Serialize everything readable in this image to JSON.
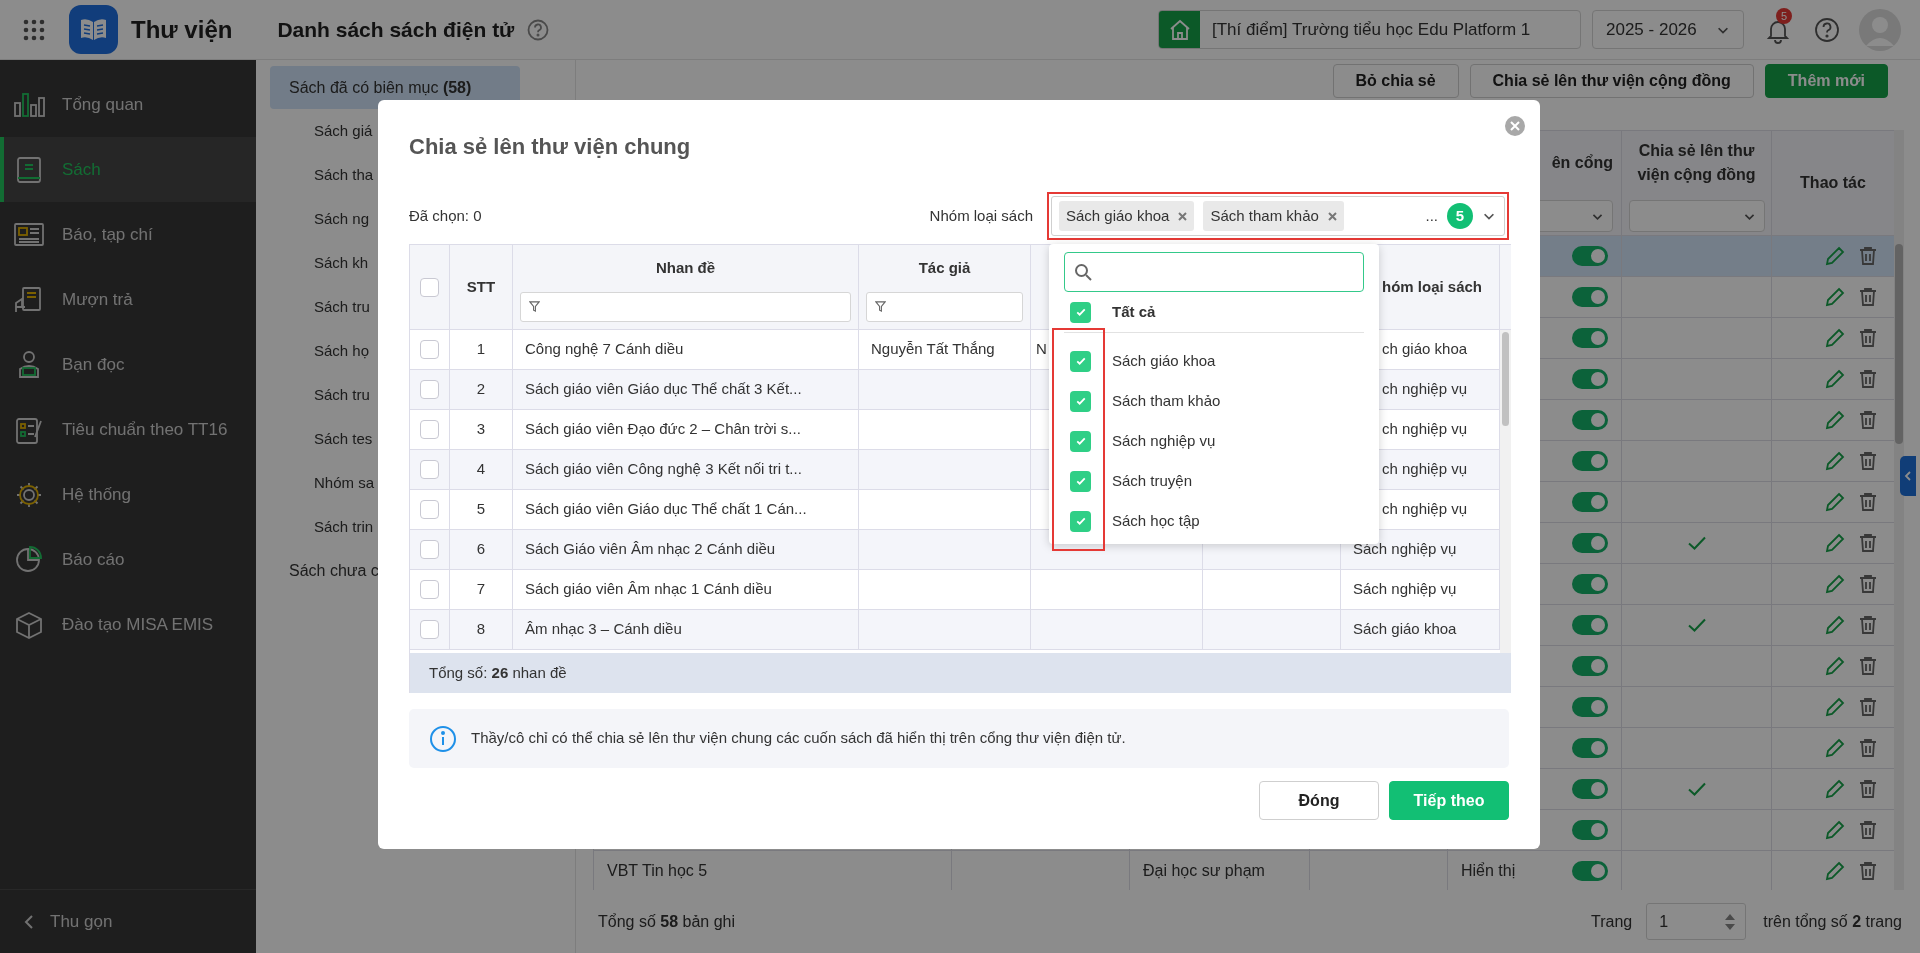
{
  "app": {
    "title": "Thư viện"
  },
  "header": {
    "title": "Danh sách sách điện tử",
    "school": "[Thí điểm] Trường tiểu học Edu Platform 1",
    "year": "2025 - 2026",
    "notification_count": "5"
  },
  "sidebar": {
    "items": [
      {
        "label": "Tổng quan",
        "kind": "overview",
        "selected": false
      },
      {
        "label": "Sách",
        "kind": "book",
        "selected": true
      },
      {
        "label": "Báo, tạp chí",
        "kind": "newspaper",
        "selected": false
      },
      {
        "label": "Mượn trả",
        "kind": "borrow",
        "selected": false
      },
      {
        "label": "Bạn đọc",
        "kind": "reader",
        "selected": false
      },
      {
        "label": "Tiêu chuẩn theo TT16",
        "kind": "checklist",
        "selected": false
      },
      {
        "label": "Hệ thống",
        "kind": "gear",
        "selected": false
      },
      {
        "label": "Báo cáo",
        "kind": "report",
        "selected": false
      },
      {
        "label": "Đào tạo MISA EMIS",
        "kind": "training",
        "selected": false
      }
    ],
    "collapse": "Thu gọn"
  },
  "categories": [
    {
      "label": "Sách đã có biên mục **(58)**",
      "selected": true,
      "children": [
        {
          "label": "Sách giá",
          "selected": false
        },
        {
          "label": "Sách tha",
          "selected": false
        },
        {
          "label": "Sách ng",
          "selected": false
        },
        {
          "label": "Sách kh",
          "selected": false
        },
        {
          "label": "Sách tru",
          "selected": false
        },
        {
          "label": "Sách họ",
          "selected": false
        },
        {
          "label": "Sách tru",
          "selected": false
        },
        {
          "label": "Sách tes",
          "selected": false
        },
        {
          "label": "Nhóm sa",
          "selected": false
        },
        {
          "label": "Sách trin",
          "selected": false
        }
      ]
    },
    {
      "label": "Sách chưa c",
      "selected": false
    }
  ],
  "toolbar": [
    {
      "label": "Bỏ chia sẻ",
      "kind": "outline"
    },
    {
      "label": "Chia sẻ lên thư viện cộng đồng",
      "kind": "outline"
    },
    {
      "label": "Thêm mới",
      "kind": "primary"
    }
  ],
  "books_table": {
    "columns": [
      "ên cổng",
      "Chia sẻ lên thư viện cộng đồng",
      "Thao tác"
    ],
    "rows": [
      {
        "selected": true,
        "on": true,
        "shared": false
      },
      {
        "selected": false,
        "on": true,
        "shared": false
      },
      {
        "selected": false,
        "on": true,
        "shared": false
      },
      {
        "selected": false,
        "on": true,
        "shared": false
      },
      {
        "selected": false,
        "on": true,
        "shared": false
      },
      {
        "selected": false,
        "on": true,
        "shared": false
      },
      {
        "selected": false,
        "on": true,
        "shared": false
      },
      {
        "selected": false,
        "on": true,
        "shared": true
      },
      {
        "selected": false,
        "on": true,
        "shared": false
      },
      {
        "selected": false,
        "on": true,
        "shared": true
      },
      {
        "selected": false,
        "on": true,
        "shared": false
      },
      {
        "selected": false,
        "on": true,
        "shared": false
      },
      {
        "selected": false,
        "on": true,
        "shared": false
      },
      {
        "selected": false,
        "on": true,
        "shared": true
      },
      {
        "selected": false,
        "on": true,
        "shared": false
      },
      {
        "selected": false,
        "on": true,
        "shared": false,
        "column_1": "VBT Tin học 5",
        "column_3": "Đại học sư phạm",
        "column_5": "Hiển thị"
      }
    ]
  },
  "footer": {
    "total": "Tổng số **58** bản ghi",
    "page_label": "Trang",
    "page": "1",
    "page_total": "trên tổng số **2** trang"
  },
  "dialog": {
    "title": "Chia sẻ lên thư viện chung",
    "selected_count": "Đã chọn: 0",
    "filter_label": "Nhóm loại sách",
    "tags": [
      "Sách giáo khoa",
      "Sách tham khảo"
    ],
    "more": "...",
    "count": "5",
    "dropdown": {
      "all": {
        "label": "Tất cả",
        "checked": true
      },
      "options": [
        {
          "label": "Sách giáo khoa",
          "checked": true
        },
        {
          "label": "Sách tham khảo",
          "checked": true
        },
        {
          "label": "Sách nghiệp vụ",
          "checked": true
        },
        {
          "label": "Sách truyện",
          "checked": true
        },
        {
          "label": "Sách học tập",
          "checked": true
        }
      ]
    },
    "table": {
      "select_all_checked": false,
      "columns": [
        "STT",
        "Nhan đề",
        "Tác giả",
        "hóm loại sách"
      ],
      "rows": [
        {
          "checked": false,
          "stt": "1",
          "title": "Công nghệ 7 Cánh diều",
          "author": "Nguyễn Tất Thắng",
          "column_4": "N",
          "group": "ch giáo khoa"
        },
        {
          "checked": false,
          "stt": "2",
          "title": "Sách giáo viên Giáo dục Thể chất 3 Kết...",
          "group": "ch nghiệp vụ"
        },
        {
          "checked": false,
          "stt": "3",
          "title": "Sách giáo viên Đạo đức 2 – Chân trời s...",
          "group": "ch nghiệp vụ"
        },
        {
          "checked": false,
          "stt": "4",
          "title": "Sách giáo viên Công nghệ 3 Kết nối tri t...",
          "group": "ch nghiệp vụ"
        },
        {
          "checked": false,
          "stt": "5",
          "title": "Sách giáo viên Giáo dục Thể chất 1 Cán...",
          "group": "ch nghiệp vụ"
        },
        {
          "checked": false,
          "stt": "6",
          "title": "Sách Giáo viên Âm nhạc 2 Cánh diều",
          "group": "Sách nghiệp vụ"
        },
        {
          "checked": false,
          "stt": "7",
          "title": "Sách giáo viên Âm nhạc 1 Cánh diều",
          "group": "Sách nghiệp vụ"
        },
        {
          "checked": false,
          "stt": "8",
          "title": "Âm nhạc 3 – Cánh diều",
          "group": "Sách giáo khoa"
        }
      ],
      "total": "Tổng số: **26** nhan đề"
    },
    "info": "Thầy/cô chỉ có thể chia sẻ lên thư viện chung các cuốn sách đã hiển thị trên cổng thư viện điện tử.",
    "buttons": [
      {
        "label": "Đóng",
        "kind": "secondary"
      },
      {
        "label": "Tiếp theo",
        "kind": "primary"
      }
    ]
  }
}
